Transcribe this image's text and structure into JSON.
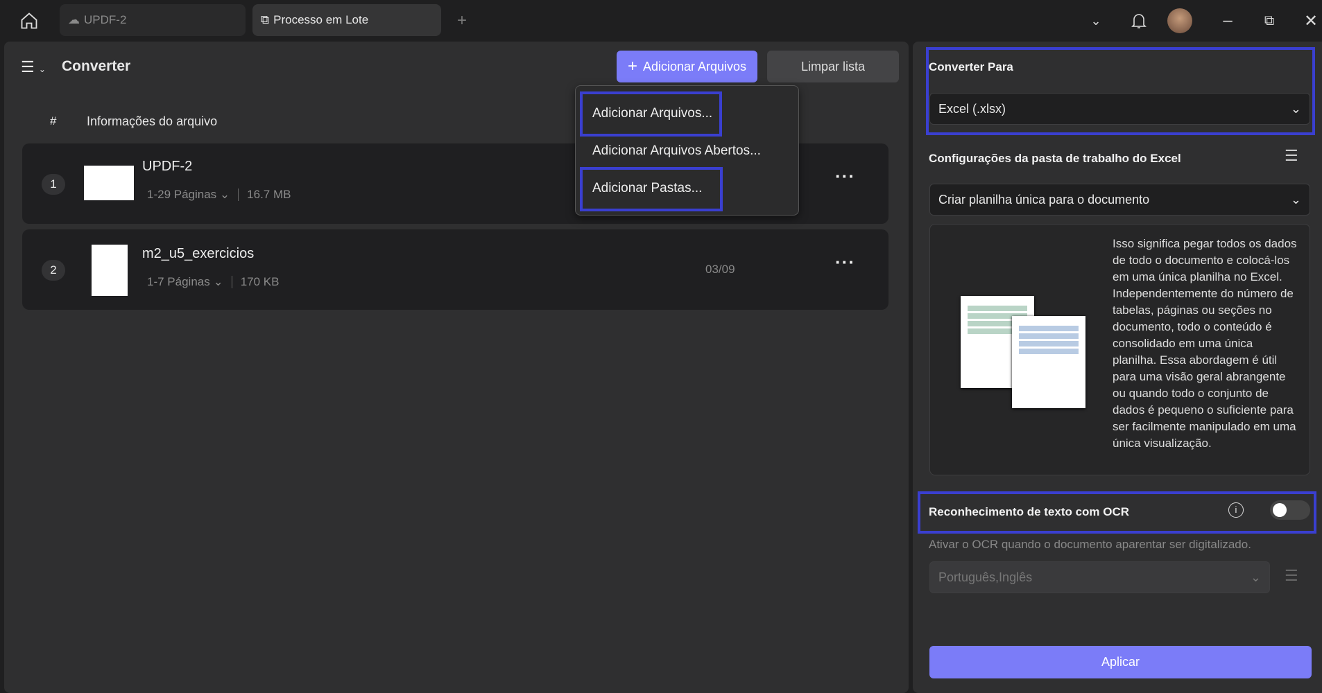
{
  "tabs": [
    {
      "label": "UPDF-2",
      "icon": "cloud-icon"
    },
    {
      "label": "Processo em Lote",
      "icon": "batch-icon"
    }
  ],
  "left": {
    "title": "Converter",
    "add_files": "Adicionar Arquivos",
    "clear_list": "Limpar lista",
    "col_num": "#",
    "col_info": "Informações do arquivo",
    "files": [
      {
        "index": "1",
        "name": "UPDF-2",
        "pages": "1-29 Páginas",
        "size": "16.7 MB",
        "date": ""
      },
      {
        "index": "2",
        "name": "m2_u5_exercicios",
        "pages": "1-7 Páginas",
        "size": "170 KB",
        "date": "03/09"
      }
    ]
  },
  "menu": {
    "items": [
      "Adicionar Arquivos...",
      "Adicionar Arquivos Abertos...",
      "Adicionar Pastas..."
    ]
  },
  "right": {
    "convert_to_label": "Converter Para",
    "convert_to_value": "Excel (.xlsx)",
    "workbook_label": "Configurações da pasta de trabalho do Excel",
    "workbook_value": "Criar planilha única para o documento",
    "description": "Isso significa pegar todos os dados de todo o documento e colocá-los em uma única planilha no Excel. Independentemente do número de tabelas, páginas ou seções no documento, todo o conteúdo é consolidado em uma única planilha. Essa abordagem é útil para uma visão geral abrangente ou quando todo o conjunto de dados é pequeno o suficiente para ser facilmente manipulado em uma única visualização.",
    "ocr_label": "Reconhecimento de texto com OCR",
    "ocr_enabled": false,
    "ocr_hint": "Ativar o OCR quando o documento aparentar ser digitalizado.",
    "ocr_lang": "Português,Inglês",
    "apply": "Aplicar"
  },
  "colors": {
    "accent": "#7b7cf8",
    "highlight": "#3a3fd0"
  }
}
